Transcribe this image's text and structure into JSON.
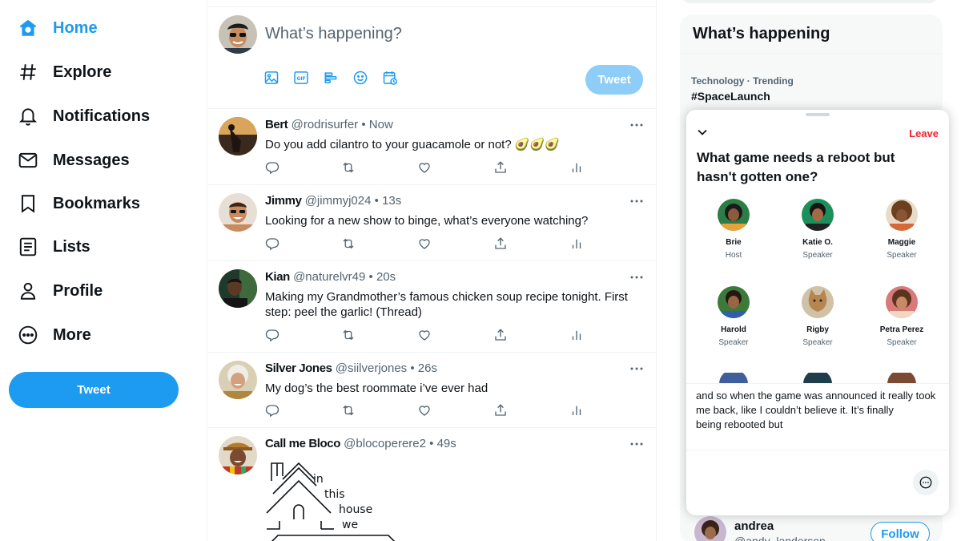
{
  "nav": {
    "items": [
      {
        "label": "Home",
        "icon": "home-icon"
      },
      {
        "label": "Explore",
        "icon": "hashtag-icon"
      },
      {
        "label": "Notifications",
        "icon": "bell-icon"
      },
      {
        "label": "Messages",
        "icon": "mail-icon"
      },
      {
        "label": "Bookmarks",
        "icon": "bookmark-icon"
      },
      {
        "label": "Lists",
        "icon": "list-icon"
      },
      {
        "label": "Profile",
        "icon": "person-icon"
      },
      {
        "label": "More",
        "icon": "more-circle-icon"
      }
    ],
    "tweet_button": "Tweet"
  },
  "compose": {
    "placeholder": "What’s happening?",
    "tools": [
      "image-icon",
      "gif-icon",
      "poll-icon",
      "emoji-icon",
      "schedule-icon"
    ],
    "tweet_button": "Tweet"
  },
  "tweets": [
    {
      "name": "Bert",
      "handle": "@rodrisurfer",
      "time": "Now",
      "text": "Do you add cilantro to your guacamole or not? 🥑🥑🥑"
    },
    {
      "name": "Jimmy",
      "handle": "@jimmyj024",
      "time": "13s",
      "text": "Looking for a new show to binge, what’s everyone watching?"
    },
    {
      "name": "Kian",
      "handle": "@naturelvr49",
      "time": "20s",
      "text": "Making my Grandmother’s famous chicken soup recipe tonight. First step: peel the garlic! (Thread)"
    },
    {
      "name": "Silver Jones",
      "handle": "@siilverjones",
      "time": "26s",
      "text": "My dog’s the best roommate i’ve ever had"
    },
    {
      "name": "Call me Bloco",
      "handle": "@blocoperere2",
      "time": "49s",
      "text": "",
      "ascii_words": [
        "in",
        "this",
        "house",
        "we"
      ]
    }
  ],
  "separator": "•",
  "trends": {
    "heading": "What’s happening",
    "items": [
      {
        "meta": "Technology · Trending",
        "tag": "#SpaceLaunch"
      }
    ]
  },
  "who_to_follow": {
    "name": "andrea",
    "handle": "@andy_landerson",
    "follow_label": "Follow"
  },
  "space": {
    "leave_label": "Leave",
    "title": "What game needs a reboot but hasn't gotten one?",
    "people": [
      {
        "name": "Brie",
        "role": "Host"
      },
      {
        "name": "Katie O.",
        "role": "Speaker"
      },
      {
        "name": "Maggie",
        "role": "Speaker"
      },
      {
        "name": "Harold",
        "role": "Speaker"
      },
      {
        "name": "Rigby",
        "role": "Speaker"
      },
      {
        "name": "Petra Perez",
        "role": "Speaker"
      }
    ],
    "caption_lines": [
      "and so when the game was announced it really took",
      "me back, like I couldn’t believe it. It’s finally",
      "being rebooted but"
    ]
  },
  "colors": {
    "accent": "#1d9bf0",
    "accent_disabled": "#8ecdf8",
    "leave": "#f4212e",
    "secondary_text": "#536471"
  }
}
